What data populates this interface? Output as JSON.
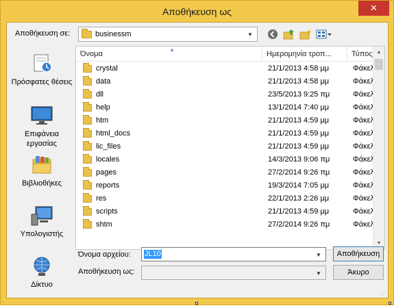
{
  "window": {
    "title": "Αποθήκευση ως",
    "close_glyph": "✕"
  },
  "header": {
    "save_in_label": "Αποθήκευση σε:",
    "save_in_value": "businessm"
  },
  "toolbar": {
    "back_icon": "back-arrow-icon",
    "up_icon": "up-folder-icon",
    "new_folder_icon": "new-folder-icon",
    "view_icon": "view-menu-icon"
  },
  "places": [
    {
      "label": "Πρόσφατες θέσεις",
      "icon": "recent-places-icon"
    },
    {
      "label": "Επιφάνεια εργασίας",
      "icon": "desktop-icon"
    },
    {
      "label": "Βιβλιοθήκες",
      "icon": "libraries-icon"
    },
    {
      "label": "Υπολογιστής",
      "icon": "computer-icon"
    },
    {
      "label": "Δίκτυο",
      "icon": "network-icon"
    }
  ],
  "list": {
    "columns": [
      "Όνομα",
      "Ημερομηνία τροπ...",
      "Τύπος"
    ],
    "rows": [
      {
        "name": "crystal",
        "date": "21/1/2013 4:58 μμ",
        "type": "Φάκελος"
      },
      {
        "name": "data",
        "date": "21/1/2013 4:58 μμ",
        "type": "Φάκελος"
      },
      {
        "name": "dll",
        "date": "23/5/2013 9:25 πμ",
        "type": "Φάκελος"
      },
      {
        "name": "help",
        "date": "13/1/2014 7:40 μμ",
        "type": "Φάκελος"
      },
      {
        "name": "htm",
        "date": "21/1/2013 4:59 μμ",
        "type": "Φάκελος"
      },
      {
        "name": "html_docs",
        "date": "21/1/2013 4:59 μμ",
        "type": "Φάκελος"
      },
      {
        "name": "lic_files",
        "date": "21/1/2013 4:59 μμ",
        "type": "Φάκελος"
      },
      {
        "name": "locales",
        "date": "14/3/2013 9:06 πμ",
        "type": "Φάκελος"
      },
      {
        "name": "pages",
        "date": "27/2/2014 9:26 πμ",
        "type": "Φάκελος"
      },
      {
        "name": "reports",
        "date": "19/3/2014 7:05 μμ",
        "type": "Φάκελος"
      },
      {
        "name": "res",
        "date": "22/1/2013 2:26 μμ",
        "type": "Φάκελος"
      },
      {
        "name": "scripts",
        "date": "21/1/2013 4:59 μμ",
        "type": "Φάκελος"
      },
      {
        "name": "shtm",
        "date": "27/2/2014 9:26 πμ",
        "type": "Φάκελος"
      }
    ]
  },
  "footer": {
    "filename_label": "Όνομα αρχείου:",
    "filename_value": "JL10",
    "filetype_label": "Αποθήκευση ως:",
    "filetype_value": "",
    "save_button": "Αποθήκευση",
    "cancel_button": "Άκυρο"
  },
  "colors": {
    "frame": "#f3c94b",
    "close": "#c7362c",
    "selection": "#3399ff"
  }
}
